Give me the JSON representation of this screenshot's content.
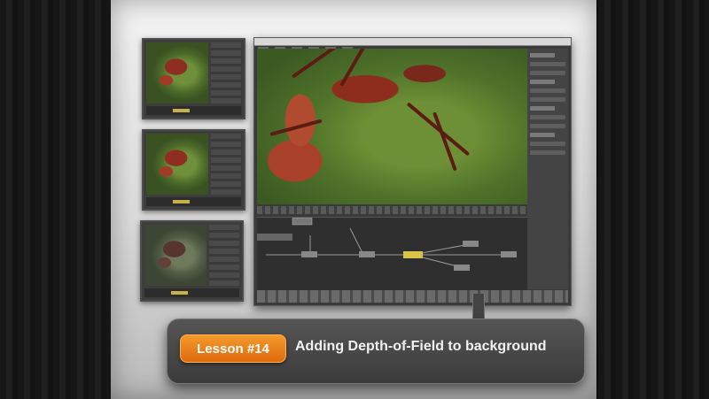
{
  "lesson": {
    "badge": "Lesson #14",
    "title": "Adding Depth-of-Field to background"
  },
  "colors": {
    "badge_orange": "#e8751a",
    "panel_gray": "#444444",
    "text_white": "#f2f2f2"
  }
}
